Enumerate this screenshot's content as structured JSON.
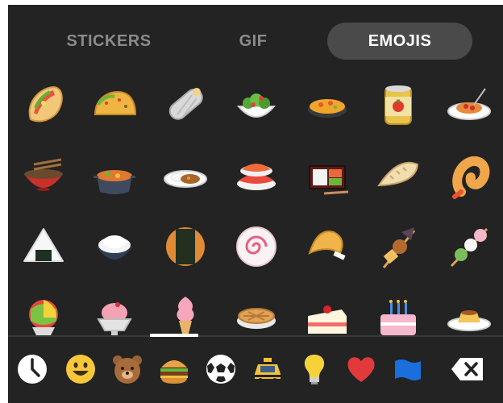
{
  "tabs": {
    "stickers": "STICKERS",
    "gif": "GIF",
    "emojis": "EMOJIS",
    "active": "emojis"
  },
  "emoji_grid": {
    "rows": [
      [
        "taco-wrap-icon",
        "taco-icon",
        "burrito-icon",
        "green-salad-icon",
        "paella-icon",
        "canned-food-icon",
        "spaghetti-icon"
      ],
      [
        "ramen-bowl-icon",
        "stew-pot-icon",
        "curry-rice-icon",
        "sushi-icon",
        "bento-box-icon",
        "dumpling-icon",
        "fried-shrimp-icon"
      ],
      [
        "rice-ball-icon",
        "cooked-rice-icon",
        "rice-cracker-icon",
        "fish-cake-icon",
        "fortune-cookie-icon",
        "oden-icon",
        "dango-icon"
      ],
      [
        "shaved-ice-icon",
        "ice-cream-icon",
        "soft-serve-icon",
        "pie-icon",
        "shortcake-icon",
        "birthday-cake-icon",
        "custard-icon"
      ]
    ]
  },
  "categories": {
    "items": [
      "clock-icon",
      "smiley-icon",
      "bear-icon",
      "hamburger-icon",
      "soccer-ball-icon",
      "taxi-icon",
      "light-bulb-icon",
      "heart-icon",
      "flag-icon"
    ],
    "active": "hamburger-icon",
    "delete": "backspace-icon"
  },
  "colors": {
    "background": "#232323",
    "tab_inactive": "#8b8b8b",
    "tab_active_bg": "#4a4a4a",
    "tab_active_text": "#ffffff"
  }
}
